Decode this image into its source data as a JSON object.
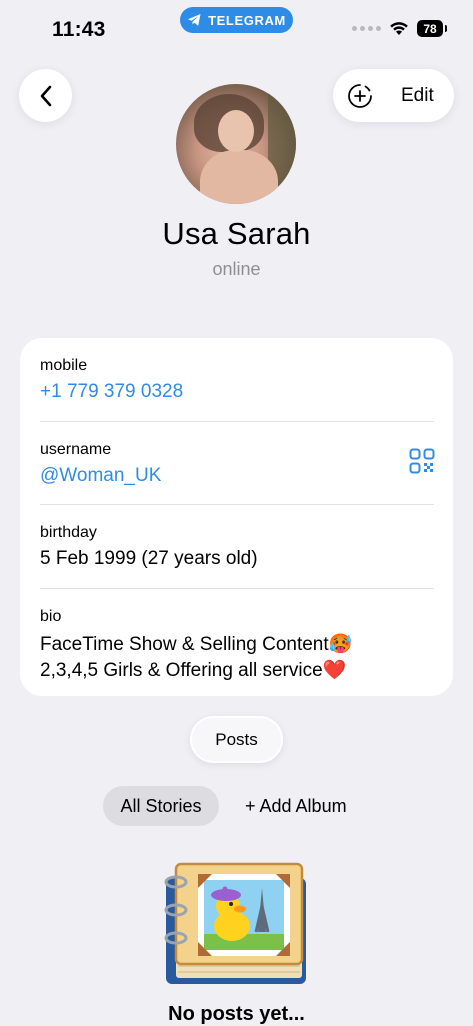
{
  "status_bar": {
    "time": "11:43",
    "telegram_label": "TELEGRAM",
    "battery": "78"
  },
  "header": {
    "edit_label": "Edit"
  },
  "profile": {
    "name": "Usa Sarah",
    "status": "online"
  },
  "info": {
    "mobile_label": "mobile",
    "mobile_value": "+1 779 379 0328",
    "username_label": "username",
    "username_value": "@Woman_UK",
    "birthday_label": "birthday",
    "birthday_value": "5 Feb 1999 (27 years old)",
    "bio_label": "bio",
    "bio_line1": "FaceTime Show & Selling Content🥵",
    "bio_line2": "2,3,4,5 Girls & Offering all service❤️"
  },
  "tabs": {
    "posts_label": "Posts",
    "all_stories_label": "All Stories",
    "add_album_label": "+ Add Album"
  },
  "empty_state": {
    "text": "No posts yet..."
  },
  "colors": {
    "accent": "#2f8ce6",
    "background": "#efeff4",
    "secondary_text": "#8e8e93"
  }
}
